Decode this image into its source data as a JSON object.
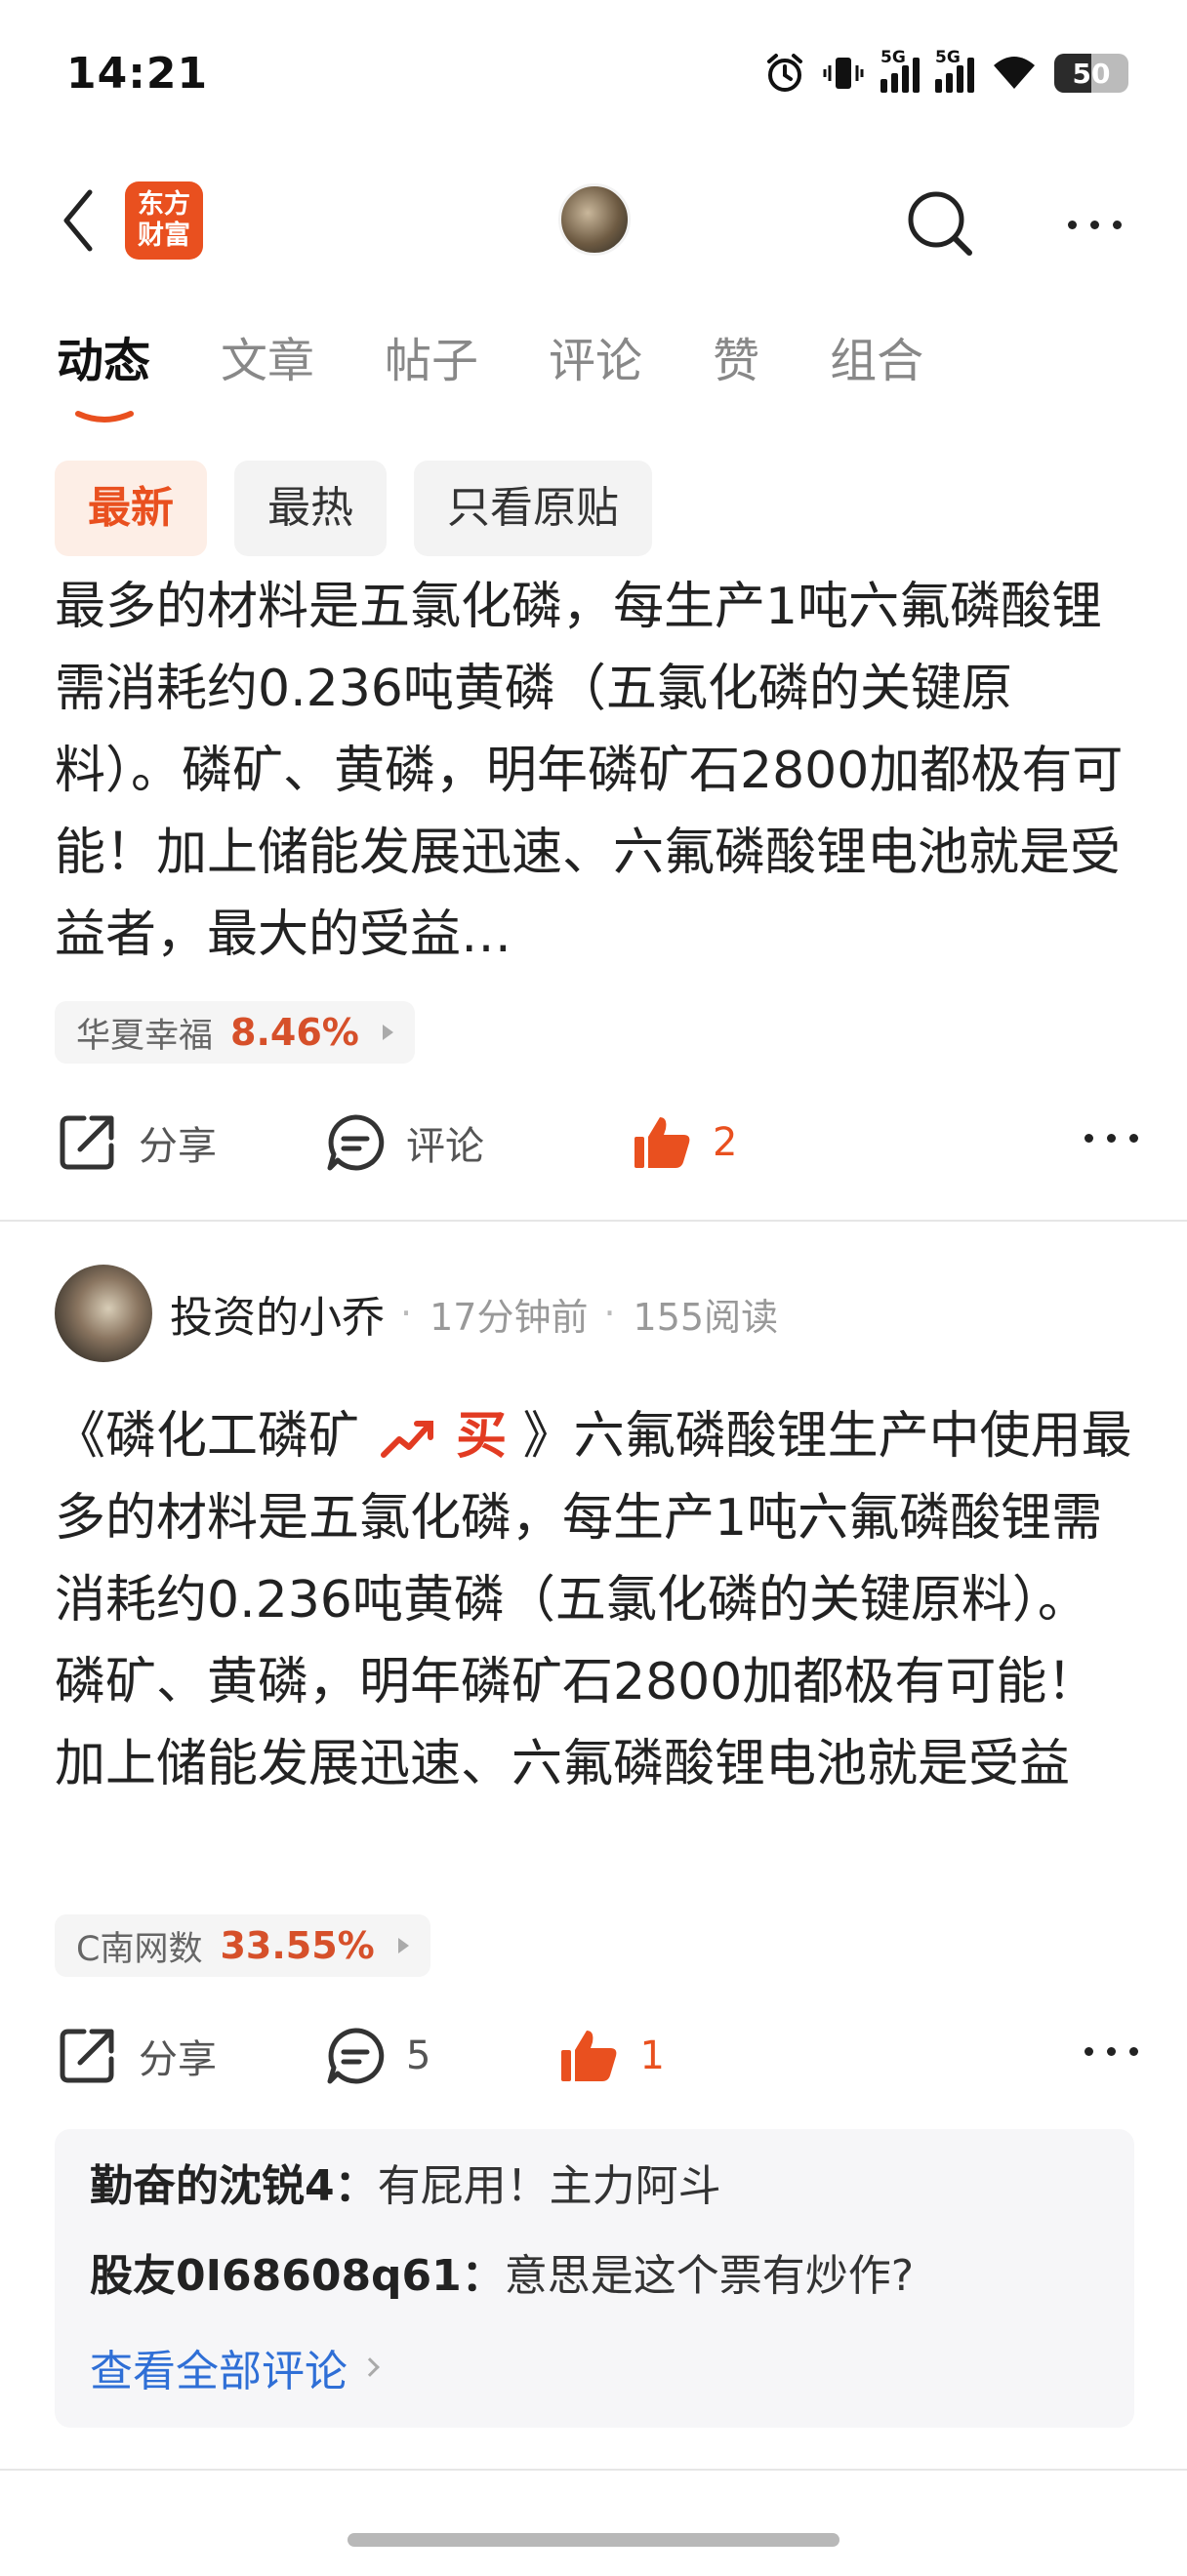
{
  "status": {
    "time": "14:21",
    "battery": "50",
    "network1": "5G",
    "network2": "5G"
  },
  "header": {
    "logo_text": "东方财富"
  },
  "tabs": [
    {
      "label": "动态"
    },
    {
      "label": "文章"
    },
    {
      "label": "帖子"
    },
    {
      "label": "评论"
    },
    {
      "label": "赞"
    },
    {
      "label": "组合"
    }
  ],
  "filters": [
    {
      "label": "最新"
    },
    {
      "label": "最热"
    },
    {
      "label": "只看原贴"
    }
  ],
  "post1": {
    "text": "最多的材料是五氯化磷，每生产1吨六氟磷酸锂需消耗约0.236吨黄磷（五氯化磷的关键原料）。磷矿、黄磷，明年磷矿石2800加都极有可能！加上储能发展迅速、六氟磷酸锂电池就是受益者，最大的受益…",
    "stock_name": "华夏幸福",
    "stock_change": "8.46%",
    "share_label": "分享",
    "comment_label": "评论",
    "like_count": "2"
  },
  "post2": {
    "author": "投资的小乔",
    "time": "17分钟前",
    "reads": "155阅读",
    "text_prefix": "《磷化工磷矿",
    "text_buy": "买",
    "text_body": "》六氟磷酸锂生产中使用最多的材料是五氯化磷，每生产1吨六氟磷酸锂需消耗约0.236吨黄磷（五氯化磷的关键原料）。磷矿、黄磷，明年磷矿石2800加都极有可能！加上储能发展迅速、六氟磷酸锂电池就是受益者，最大的受…",
    "stock_name": "C南网数",
    "stock_change": "33.55%",
    "share_label": "分享",
    "comment_count": "5",
    "like_count": "1",
    "comments": [
      {
        "user": "勤奋的沈锐4：",
        "text": "有屁用！主力阿斗"
      },
      {
        "user": "股友0I68608q61：",
        "text": "意思是这个票有炒作?"
      }
    ],
    "view_all": "查看全部评论"
  },
  "colors": {
    "accent": "#e9501f",
    "link": "#2f6fd6",
    "gain": "#d6502a"
  }
}
